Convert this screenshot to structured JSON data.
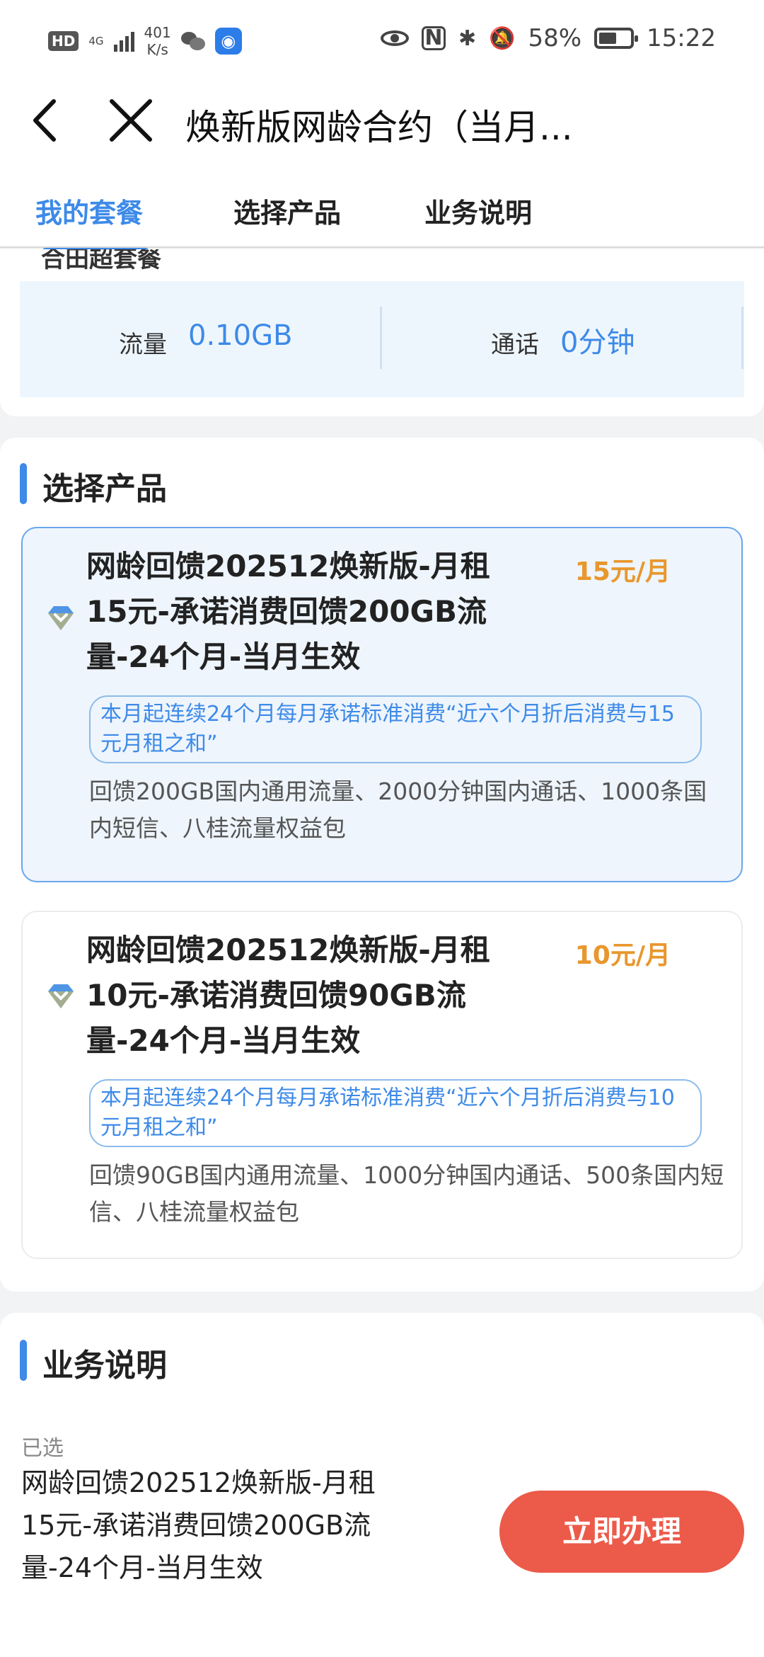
{
  "status_bar": {
    "hd": "HD",
    "network": "4G",
    "speed_value": "401",
    "speed_unit": "K/s",
    "nfc": "N",
    "battery": "58%",
    "battery_level": 0.58,
    "time": "15:22"
  },
  "header": {
    "title": "焕新版网龄合约（当月...",
    "tabs": [
      {
        "label": "我的套餐",
        "active": true
      },
      {
        "label": "选择产品",
        "active": false
      },
      {
        "label": "业务说明",
        "active": false
      }
    ]
  },
  "my_plan": {
    "cut_heading": "合田超套餐",
    "data_label": "流量",
    "data_value": "0.10GB",
    "call_label": "通话",
    "call_value": "0分钟"
  },
  "products": {
    "heading": "选择产品",
    "items": [
      {
        "name": "网龄回馈202512焕新版-月租15元-承诺消费回馈200GB流量-24个月-当月生效",
        "price": "15元/月",
        "promise": "本月起连续24个月每月承诺标准消费“近六个月折后消费与15元月租之和”",
        "benefit": "回馈200GB国内通用流量、2000分钟国内通话、1000条国内短信、八桂流量权益包",
        "selected": true
      },
      {
        "name": "网龄回馈202512焕新版-月租10元-承诺消费回馈90GB流量-24个月-当月生效",
        "price": "10元/月",
        "promise": "本月起连续24个月每月承诺标准消费“近六个月折后消费与10元月租之和”",
        "benefit": "回馈90GB国内通用流量、1000分钟国内通话、500条国内短信、八桂流量权益包",
        "selected": false
      }
    ]
  },
  "description": {
    "heading": "业务说明",
    "selected_label": "已选",
    "selected_name": "网龄回馈202512焕新版-月租15元-承诺消费回馈200GB流量-24个月-当月生效",
    "submit_label": "立即办理"
  },
  "colors": {
    "accent": "#3d8ae8",
    "price": "#e8972e",
    "submit": "#ec5a4a"
  }
}
